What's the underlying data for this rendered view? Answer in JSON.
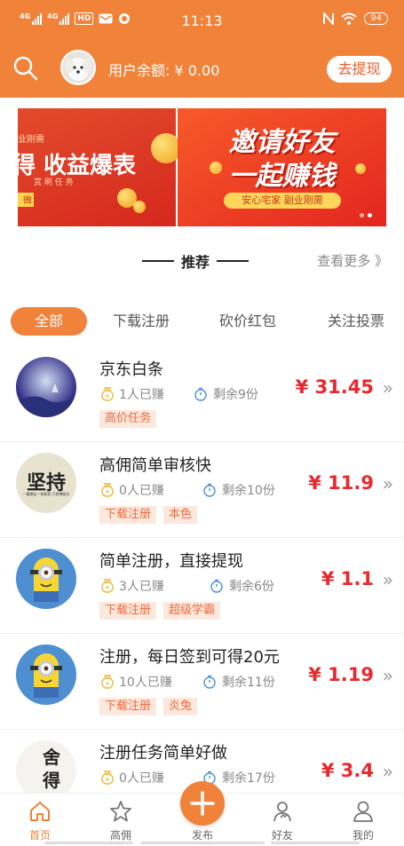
{
  "status_bar": {
    "sim1": "4G",
    "sim2": "4G",
    "hd": "HD",
    "time": "11:13",
    "battery": "94"
  },
  "header": {
    "balance": "用户余额: ¥ 0.00",
    "withdraw_label": "去提现"
  },
  "banner": {
    "slide1_small": "业刚需",
    "slide1_big": "得 收益爆表",
    "slide1_sub": "赏 刷 任 务",
    "slide1_tag": "微",
    "slide2_title_line1": "邀请好友",
    "slide2_title_line2": "一起赚钱",
    "slide2_pill": "安心宅家 副业刚需"
  },
  "recommend": {
    "title": "推荐",
    "see_more": "查看更多 》"
  },
  "tabs": [
    "全部",
    "下载注册",
    "砍价红包",
    "关注投票"
  ],
  "tasks": [
    {
      "title": "京东白条",
      "earned": "1人已赚",
      "remaining": "剩余9份",
      "tags": [
        "高价任务"
      ],
      "price": "¥ 31.45"
    },
    {
      "title": "高佣简单审核快",
      "earned": "0人已赚",
      "remaining": "剩余10份",
      "tags": [
        "下载注册",
        "本色"
      ],
      "price": "¥ 11.9",
      "thumb_text": "坚持",
      "thumb_small": "一番耕耘一份收获 只拼搏前方"
    },
    {
      "title": "简单注册，直接提现",
      "earned": "3人已赚",
      "remaining": "剩余6份",
      "tags": [
        "下载注册",
        "超级学霸"
      ],
      "price": "¥ 1.1"
    },
    {
      "title": "注册，每日签到可得20元",
      "earned": "10人已赚",
      "remaining": "剩余11份",
      "tags": [
        "下载注册",
        "炎兔"
      ],
      "price": "¥ 1.19"
    },
    {
      "title": "注册任务简单好做",
      "earned": "0人已赚",
      "remaining": "剩余17份",
      "tags": [],
      "price": "¥ 3.4",
      "thumb_text": "舍得"
    }
  ],
  "bottom_nav": [
    "首页",
    "高佣",
    "发布",
    "好友",
    "我的"
  ],
  "colors": {
    "brand": "#f0823a",
    "price": "#e8292f",
    "tag_bg": "#fde8de",
    "tag_text": "#ee6a3a"
  }
}
